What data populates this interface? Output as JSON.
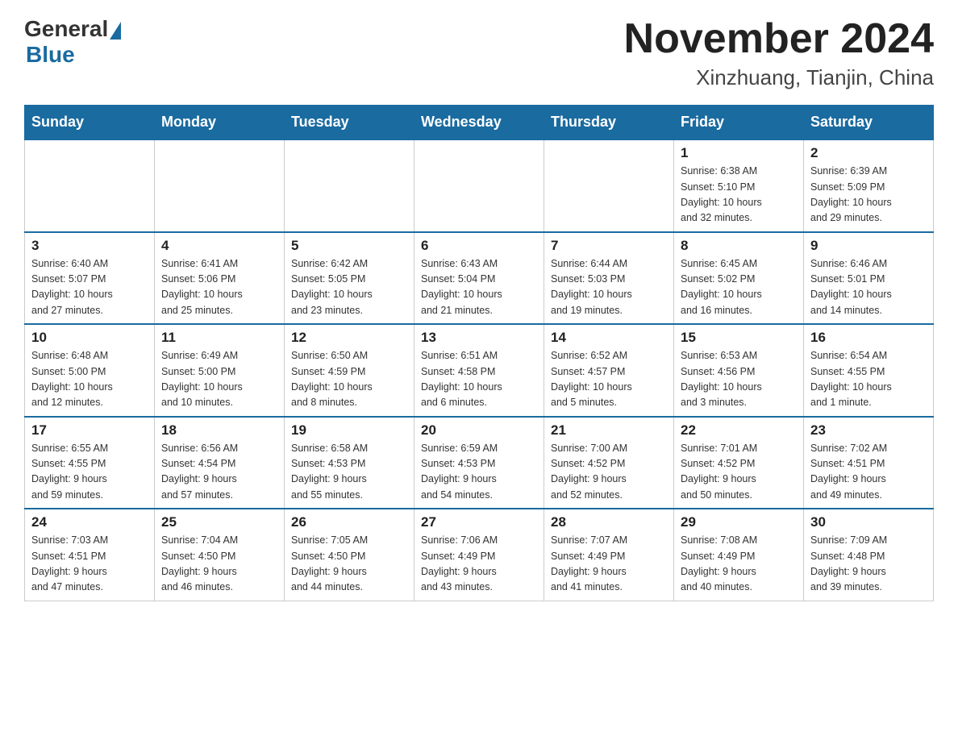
{
  "header": {
    "logo_general": "General",
    "logo_blue": "Blue",
    "month_year": "November 2024",
    "location": "Xinzhuang, Tianjin, China"
  },
  "weekdays": [
    "Sunday",
    "Monday",
    "Tuesday",
    "Wednesday",
    "Thursday",
    "Friday",
    "Saturday"
  ],
  "weeks": [
    [
      {
        "day": "",
        "info": ""
      },
      {
        "day": "",
        "info": ""
      },
      {
        "day": "",
        "info": ""
      },
      {
        "day": "",
        "info": ""
      },
      {
        "day": "",
        "info": ""
      },
      {
        "day": "1",
        "info": "Sunrise: 6:38 AM\nSunset: 5:10 PM\nDaylight: 10 hours\nand 32 minutes."
      },
      {
        "day": "2",
        "info": "Sunrise: 6:39 AM\nSunset: 5:09 PM\nDaylight: 10 hours\nand 29 minutes."
      }
    ],
    [
      {
        "day": "3",
        "info": "Sunrise: 6:40 AM\nSunset: 5:07 PM\nDaylight: 10 hours\nand 27 minutes."
      },
      {
        "day": "4",
        "info": "Sunrise: 6:41 AM\nSunset: 5:06 PM\nDaylight: 10 hours\nand 25 minutes."
      },
      {
        "day": "5",
        "info": "Sunrise: 6:42 AM\nSunset: 5:05 PM\nDaylight: 10 hours\nand 23 minutes."
      },
      {
        "day": "6",
        "info": "Sunrise: 6:43 AM\nSunset: 5:04 PM\nDaylight: 10 hours\nand 21 minutes."
      },
      {
        "day": "7",
        "info": "Sunrise: 6:44 AM\nSunset: 5:03 PM\nDaylight: 10 hours\nand 19 minutes."
      },
      {
        "day": "8",
        "info": "Sunrise: 6:45 AM\nSunset: 5:02 PM\nDaylight: 10 hours\nand 16 minutes."
      },
      {
        "day": "9",
        "info": "Sunrise: 6:46 AM\nSunset: 5:01 PM\nDaylight: 10 hours\nand 14 minutes."
      }
    ],
    [
      {
        "day": "10",
        "info": "Sunrise: 6:48 AM\nSunset: 5:00 PM\nDaylight: 10 hours\nand 12 minutes."
      },
      {
        "day": "11",
        "info": "Sunrise: 6:49 AM\nSunset: 5:00 PM\nDaylight: 10 hours\nand 10 minutes."
      },
      {
        "day": "12",
        "info": "Sunrise: 6:50 AM\nSunset: 4:59 PM\nDaylight: 10 hours\nand 8 minutes."
      },
      {
        "day": "13",
        "info": "Sunrise: 6:51 AM\nSunset: 4:58 PM\nDaylight: 10 hours\nand 6 minutes."
      },
      {
        "day": "14",
        "info": "Sunrise: 6:52 AM\nSunset: 4:57 PM\nDaylight: 10 hours\nand 5 minutes."
      },
      {
        "day": "15",
        "info": "Sunrise: 6:53 AM\nSunset: 4:56 PM\nDaylight: 10 hours\nand 3 minutes."
      },
      {
        "day": "16",
        "info": "Sunrise: 6:54 AM\nSunset: 4:55 PM\nDaylight: 10 hours\nand 1 minute."
      }
    ],
    [
      {
        "day": "17",
        "info": "Sunrise: 6:55 AM\nSunset: 4:55 PM\nDaylight: 9 hours\nand 59 minutes."
      },
      {
        "day": "18",
        "info": "Sunrise: 6:56 AM\nSunset: 4:54 PM\nDaylight: 9 hours\nand 57 minutes."
      },
      {
        "day": "19",
        "info": "Sunrise: 6:58 AM\nSunset: 4:53 PM\nDaylight: 9 hours\nand 55 minutes."
      },
      {
        "day": "20",
        "info": "Sunrise: 6:59 AM\nSunset: 4:53 PM\nDaylight: 9 hours\nand 54 minutes."
      },
      {
        "day": "21",
        "info": "Sunrise: 7:00 AM\nSunset: 4:52 PM\nDaylight: 9 hours\nand 52 minutes."
      },
      {
        "day": "22",
        "info": "Sunrise: 7:01 AM\nSunset: 4:52 PM\nDaylight: 9 hours\nand 50 minutes."
      },
      {
        "day": "23",
        "info": "Sunrise: 7:02 AM\nSunset: 4:51 PM\nDaylight: 9 hours\nand 49 minutes."
      }
    ],
    [
      {
        "day": "24",
        "info": "Sunrise: 7:03 AM\nSunset: 4:51 PM\nDaylight: 9 hours\nand 47 minutes."
      },
      {
        "day": "25",
        "info": "Sunrise: 7:04 AM\nSunset: 4:50 PM\nDaylight: 9 hours\nand 46 minutes."
      },
      {
        "day": "26",
        "info": "Sunrise: 7:05 AM\nSunset: 4:50 PM\nDaylight: 9 hours\nand 44 minutes."
      },
      {
        "day": "27",
        "info": "Sunrise: 7:06 AM\nSunset: 4:49 PM\nDaylight: 9 hours\nand 43 minutes."
      },
      {
        "day": "28",
        "info": "Sunrise: 7:07 AM\nSunset: 4:49 PM\nDaylight: 9 hours\nand 41 minutes."
      },
      {
        "day": "29",
        "info": "Sunrise: 7:08 AM\nSunset: 4:49 PM\nDaylight: 9 hours\nand 40 minutes."
      },
      {
        "day": "30",
        "info": "Sunrise: 7:09 AM\nSunset: 4:48 PM\nDaylight: 9 hours\nand 39 minutes."
      }
    ]
  ]
}
